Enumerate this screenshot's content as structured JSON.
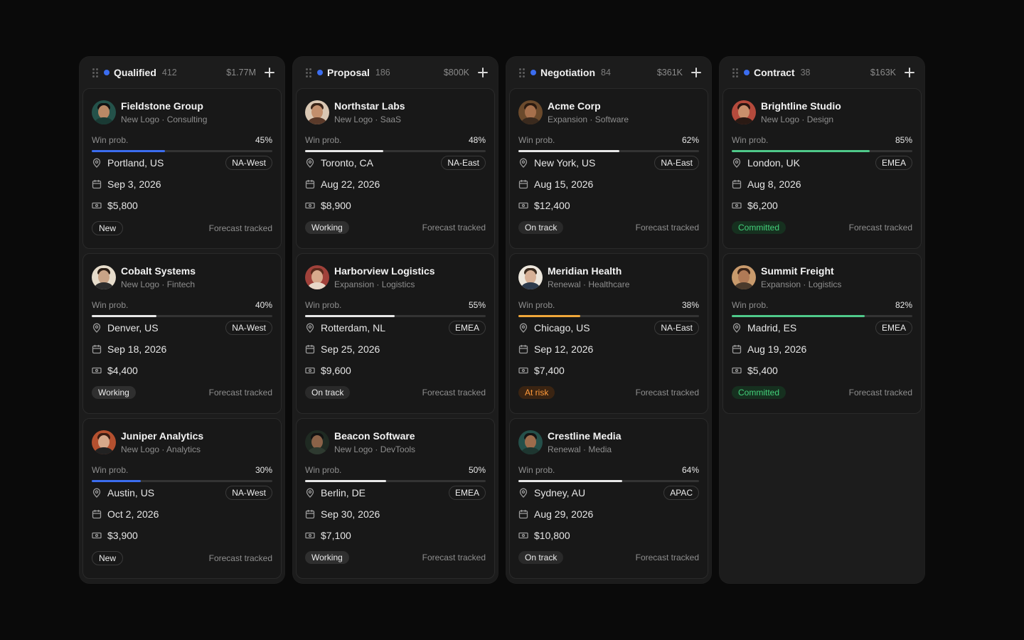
{
  "colors": {
    "accent": "#3b6df0",
    "blue_bar": "#3b6df0",
    "white_bar": "#e8e8e8",
    "green_bar": "#4fc98a",
    "orange_bar": "#f0a73a"
  },
  "columns": [
    {
      "title": "Qualified",
      "count": "412",
      "total": "$1.77M",
      "cards": [
        {
          "company": "Fieldstone Group",
          "meta": "New Logo · Consulting",
          "win_label": "Win prob.",
          "win": "45%",
          "win_frac": 0.45,
          "bar_color": "#3b6df0",
          "location": "Portland, US",
          "region": "NA-West",
          "date": "Sep 3, 2026",
          "amount": "$5,800",
          "status": "New",
          "status_kind": "new",
          "forecast": "Forecast tracked",
          "avatar": {
            "bg": "#24524a",
            "hair": "#111",
            "body": "#1a3a34",
            "skin": "#b98966"
          }
        },
        {
          "company": "Cobalt Systems",
          "meta": "New Logo · Fintech",
          "win_label": "Win prob.",
          "win": "40%",
          "win_frac": 0.4,
          "bar_color": "#e8e8e8",
          "location": "Denver, US",
          "region": "NA-West",
          "date": "Sep 18, 2026",
          "amount": "$4,400",
          "status": "Working",
          "status_kind": "working",
          "forecast": "Forecast tracked",
          "avatar": {
            "bg": "#e6dccb",
            "hair": "#2a1d14",
            "body": "#2c2c2c",
            "skin": "#c9a487"
          }
        },
        {
          "company": "Juniper Analytics",
          "meta": "New Logo · Analytics",
          "win_label": "Win prob.",
          "win": "30%",
          "win_frac": 0.3,
          "bar_color": "#3b6df0",
          "location": "Austin, US",
          "region": "NA-West",
          "date": "Oct 2, 2026",
          "amount": "$3,900",
          "status": "New",
          "status_kind": "new",
          "forecast": "Forecast tracked",
          "avatar": {
            "bg": "#b4502f",
            "hair": "#3b1c12",
            "body": "#222",
            "skin": "#d5a88a"
          }
        }
      ]
    },
    {
      "title": "Proposal",
      "count": "186",
      "total": "$800K",
      "cards": [
        {
          "company": "Northstar Labs",
          "meta": "New Logo · SaaS",
          "win_label": "Win prob.",
          "win": "48%",
          "win_frac": 0.48,
          "bar_color": "#e8e8e8",
          "location": "Toronto, CA",
          "region": "NA-East",
          "date": "Aug 22, 2026",
          "amount": "$8,900",
          "status": "Working",
          "status_kind": "working",
          "forecast": "Forecast tracked",
          "avatar": {
            "bg": "#d9c7b3",
            "hair": "#3a2418",
            "body": "#5a3a2a",
            "skin": "#c28f6d"
          }
        },
        {
          "company": "Harborview Logistics",
          "meta": "Expansion · Logistics",
          "win_label": "Win prob.",
          "win": "55%",
          "win_frac": 0.55,
          "bar_color": "#e8e8e8",
          "location": "Rotterdam, NL",
          "region": "EMEA",
          "date": "Sep 25, 2026",
          "amount": "$9,600",
          "status": "On track",
          "status_kind": "ontrack",
          "forecast": "Forecast tracked",
          "avatar": {
            "bg": "#a0413a",
            "hair": "#5a2a1c",
            "body": "#e8d8c8",
            "skin": "#d8aa8c"
          }
        },
        {
          "company": "Beacon Software",
          "meta": "New Logo · DevTools",
          "win_label": "Win prob.",
          "win": "50%",
          "win_frac": 0.5,
          "bar_color": "#e8e8e8",
          "location": "Berlin, DE",
          "region": "EMEA",
          "date": "Sep 30, 2026",
          "amount": "$7,100",
          "status": "Working",
          "status_kind": "working",
          "forecast": "Forecast tracked",
          "avatar": {
            "bg": "#1f2a22",
            "hair": "#121212",
            "body": "#2e3a30",
            "skin": "#8a6248"
          }
        }
      ]
    },
    {
      "title": "Negotiation",
      "count": "84",
      "total": "$361K",
      "cards": [
        {
          "company": "Acme Corp",
          "meta": "Expansion · Software",
          "win_label": "Win prob.",
          "win": "62%",
          "win_frac": 0.62,
          "bar_color": "#e8e8e8",
          "location": "New York, US",
          "region": "NA-East",
          "date": "Aug 15, 2026",
          "amount": "$12,400",
          "status": "On track",
          "status_kind": "ontrack",
          "forecast": "Forecast tracked",
          "avatar": {
            "bg": "#6b4a2c",
            "hair": "#2a1a10",
            "body": "#3a2a1e",
            "skin": "#a6704c"
          }
        },
        {
          "company": "Meridian Health",
          "meta": "Renewal · Healthcare",
          "win_label": "Win prob.",
          "win": "38%",
          "win_frac": 0.38,
          "bar_color": "#f0a73a",
          "location": "Chicago, US",
          "region": "NA-East",
          "date": "Sep 12, 2026",
          "amount": "$7,400",
          "status": "At risk",
          "status_kind": "atrisk",
          "forecast": "Forecast tracked",
          "avatar": {
            "bg": "#ece6dc",
            "hair": "#3a2a1e",
            "body": "#2c3a4c",
            "skin": "#d6b096"
          }
        },
        {
          "company": "Crestline Media",
          "meta": "Renewal · Media",
          "win_label": "Win prob.",
          "win": "64%",
          "win_frac": 0.64,
          "bar_color": "#e8e8e8",
          "location": "Sydney, AU",
          "region": "APAC",
          "date": "Aug 29, 2026",
          "amount": "$10,800",
          "status": "On track",
          "status_kind": "ontrack",
          "forecast": "Forecast tracked",
          "avatar": {
            "bg": "#25504a",
            "hair": "#141414",
            "body": "#1e3630",
            "skin": "#9c6c4c"
          }
        }
      ]
    },
    {
      "title": "Contract",
      "count": "38",
      "total": "$163K",
      "cards": [
        {
          "company": "Brightline Studio",
          "meta": "New Logo · Design",
          "win_label": "Win prob.",
          "win": "85%",
          "win_frac": 0.85,
          "bar_color": "#4fc98a",
          "location": "London, UK",
          "region": "EMEA",
          "date": "Aug 8, 2026",
          "amount": "$6,200",
          "status": "Committed",
          "status_kind": "committed",
          "forecast": "Forecast tracked",
          "avatar": {
            "bg": "#b44a3c",
            "hair": "#2a1510",
            "body": "#2a1a14",
            "skin": "#c8906c"
          }
        },
        {
          "company": "Summit Freight",
          "meta": "Expansion · Logistics",
          "win_label": "Win prob.",
          "win": "82%",
          "win_frac": 0.82,
          "bar_color": "#4fc98a",
          "location": "Madrid, ES",
          "region": "EMEA",
          "date": "Aug 19, 2026",
          "amount": "$5,400",
          "status": "Committed",
          "status_kind": "committed",
          "forecast": "Forecast tracked",
          "avatar": {
            "bg": "#c89a6c",
            "hair": "#3a2418",
            "body": "#4a3a2c",
            "skin": "#b07a56"
          }
        }
      ]
    }
  ]
}
